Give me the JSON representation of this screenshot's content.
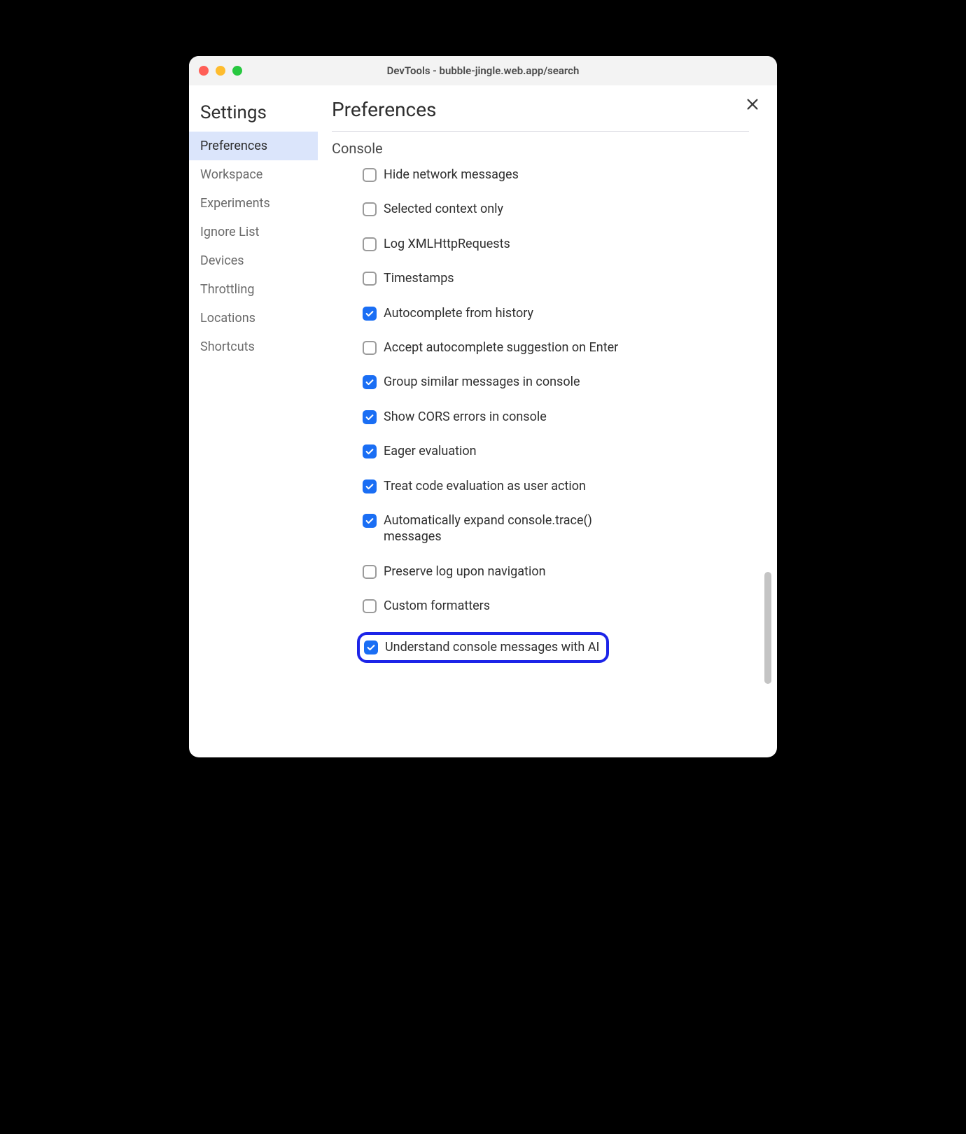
{
  "window": {
    "title": "DevTools - bubble-jingle.web.app/search"
  },
  "sidebar": {
    "title": "Settings",
    "items": [
      {
        "label": "Preferences",
        "active": true
      },
      {
        "label": "Workspace",
        "active": false
      },
      {
        "label": "Experiments",
        "active": false
      },
      {
        "label": "Ignore List",
        "active": false
      },
      {
        "label": "Devices",
        "active": false
      },
      {
        "label": "Throttling",
        "active": false
      },
      {
        "label": "Locations",
        "active": false
      },
      {
        "label": "Shortcuts",
        "active": false
      }
    ]
  },
  "main": {
    "title": "Preferences",
    "section_title": "Console",
    "settings": [
      {
        "label": "Hide network messages",
        "checked": false,
        "highlighted": false
      },
      {
        "label": "Selected context only",
        "checked": false,
        "highlighted": false
      },
      {
        "label": "Log XMLHttpRequests",
        "checked": false,
        "highlighted": false
      },
      {
        "label": "Timestamps",
        "checked": false,
        "highlighted": false
      },
      {
        "label": "Autocomplete from history",
        "checked": true,
        "highlighted": false
      },
      {
        "label": "Accept autocomplete suggestion on Enter",
        "checked": false,
        "highlighted": false
      },
      {
        "label": "Group similar messages in console",
        "checked": true,
        "highlighted": false
      },
      {
        "label": "Show CORS errors in console",
        "checked": true,
        "highlighted": false
      },
      {
        "label": "Eager evaluation",
        "checked": true,
        "highlighted": false
      },
      {
        "label": "Treat code evaluation as user action",
        "checked": true,
        "highlighted": false
      },
      {
        "label": "Automatically expand console.trace() messages",
        "checked": true,
        "highlighted": false
      },
      {
        "label": "Preserve log upon navigation",
        "checked": false,
        "highlighted": false
      },
      {
        "label": "Custom formatters",
        "checked": false,
        "highlighted": false
      },
      {
        "label": "Understand console messages with AI",
        "checked": true,
        "highlighted": true
      }
    ]
  }
}
